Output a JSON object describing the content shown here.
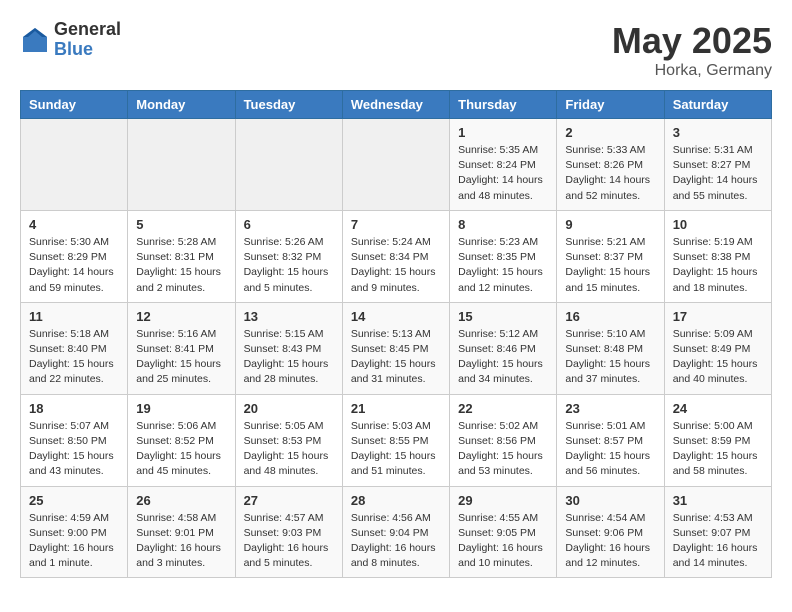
{
  "header": {
    "logo_general": "General",
    "logo_blue": "Blue",
    "title": "May 2025",
    "location": "Horka, Germany"
  },
  "weekdays": [
    "Sunday",
    "Monday",
    "Tuesday",
    "Wednesday",
    "Thursday",
    "Friday",
    "Saturday"
  ],
  "weeks": [
    [
      {
        "day": "",
        "info": ""
      },
      {
        "day": "",
        "info": ""
      },
      {
        "day": "",
        "info": ""
      },
      {
        "day": "",
        "info": ""
      },
      {
        "day": "1",
        "info": "Sunrise: 5:35 AM\nSunset: 8:24 PM\nDaylight: 14 hours\nand 48 minutes."
      },
      {
        "day": "2",
        "info": "Sunrise: 5:33 AM\nSunset: 8:26 PM\nDaylight: 14 hours\nand 52 minutes."
      },
      {
        "day": "3",
        "info": "Sunrise: 5:31 AM\nSunset: 8:27 PM\nDaylight: 14 hours\nand 55 minutes."
      }
    ],
    [
      {
        "day": "4",
        "info": "Sunrise: 5:30 AM\nSunset: 8:29 PM\nDaylight: 14 hours\nand 59 minutes."
      },
      {
        "day": "5",
        "info": "Sunrise: 5:28 AM\nSunset: 8:31 PM\nDaylight: 15 hours\nand 2 minutes."
      },
      {
        "day": "6",
        "info": "Sunrise: 5:26 AM\nSunset: 8:32 PM\nDaylight: 15 hours\nand 5 minutes."
      },
      {
        "day": "7",
        "info": "Sunrise: 5:24 AM\nSunset: 8:34 PM\nDaylight: 15 hours\nand 9 minutes."
      },
      {
        "day": "8",
        "info": "Sunrise: 5:23 AM\nSunset: 8:35 PM\nDaylight: 15 hours\nand 12 minutes."
      },
      {
        "day": "9",
        "info": "Sunrise: 5:21 AM\nSunset: 8:37 PM\nDaylight: 15 hours\nand 15 minutes."
      },
      {
        "day": "10",
        "info": "Sunrise: 5:19 AM\nSunset: 8:38 PM\nDaylight: 15 hours\nand 18 minutes."
      }
    ],
    [
      {
        "day": "11",
        "info": "Sunrise: 5:18 AM\nSunset: 8:40 PM\nDaylight: 15 hours\nand 22 minutes."
      },
      {
        "day": "12",
        "info": "Sunrise: 5:16 AM\nSunset: 8:41 PM\nDaylight: 15 hours\nand 25 minutes."
      },
      {
        "day": "13",
        "info": "Sunrise: 5:15 AM\nSunset: 8:43 PM\nDaylight: 15 hours\nand 28 minutes."
      },
      {
        "day": "14",
        "info": "Sunrise: 5:13 AM\nSunset: 8:45 PM\nDaylight: 15 hours\nand 31 minutes."
      },
      {
        "day": "15",
        "info": "Sunrise: 5:12 AM\nSunset: 8:46 PM\nDaylight: 15 hours\nand 34 minutes."
      },
      {
        "day": "16",
        "info": "Sunrise: 5:10 AM\nSunset: 8:48 PM\nDaylight: 15 hours\nand 37 minutes."
      },
      {
        "day": "17",
        "info": "Sunrise: 5:09 AM\nSunset: 8:49 PM\nDaylight: 15 hours\nand 40 minutes."
      }
    ],
    [
      {
        "day": "18",
        "info": "Sunrise: 5:07 AM\nSunset: 8:50 PM\nDaylight: 15 hours\nand 43 minutes."
      },
      {
        "day": "19",
        "info": "Sunrise: 5:06 AM\nSunset: 8:52 PM\nDaylight: 15 hours\nand 45 minutes."
      },
      {
        "day": "20",
        "info": "Sunrise: 5:05 AM\nSunset: 8:53 PM\nDaylight: 15 hours\nand 48 minutes."
      },
      {
        "day": "21",
        "info": "Sunrise: 5:03 AM\nSunset: 8:55 PM\nDaylight: 15 hours\nand 51 minutes."
      },
      {
        "day": "22",
        "info": "Sunrise: 5:02 AM\nSunset: 8:56 PM\nDaylight: 15 hours\nand 53 minutes."
      },
      {
        "day": "23",
        "info": "Sunrise: 5:01 AM\nSunset: 8:57 PM\nDaylight: 15 hours\nand 56 minutes."
      },
      {
        "day": "24",
        "info": "Sunrise: 5:00 AM\nSunset: 8:59 PM\nDaylight: 15 hours\nand 58 minutes."
      }
    ],
    [
      {
        "day": "25",
        "info": "Sunrise: 4:59 AM\nSunset: 9:00 PM\nDaylight: 16 hours\nand 1 minute."
      },
      {
        "day": "26",
        "info": "Sunrise: 4:58 AM\nSunset: 9:01 PM\nDaylight: 16 hours\nand 3 minutes."
      },
      {
        "day": "27",
        "info": "Sunrise: 4:57 AM\nSunset: 9:03 PM\nDaylight: 16 hours\nand 5 minutes."
      },
      {
        "day": "28",
        "info": "Sunrise: 4:56 AM\nSunset: 9:04 PM\nDaylight: 16 hours\nand 8 minutes."
      },
      {
        "day": "29",
        "info": "Sunrise: 4:55 AM\nSunset: 9:05 PM\nDaylight: 16 hours\nand 10 minutes."
      },
      {
        "day": "30",
        "info": "Sunrise: 4:54 AM\nSunset: 9:06 PM\nDaylight: 16 hours\nand 12 minutes."
      },
      {
        "day": "31",
        "info": "Sunrise: 4:53 AM\nSunset: 9:07 PM\nDaylight: 16 hours\nand 14 minutes."
      }
    ]
  ]
}
